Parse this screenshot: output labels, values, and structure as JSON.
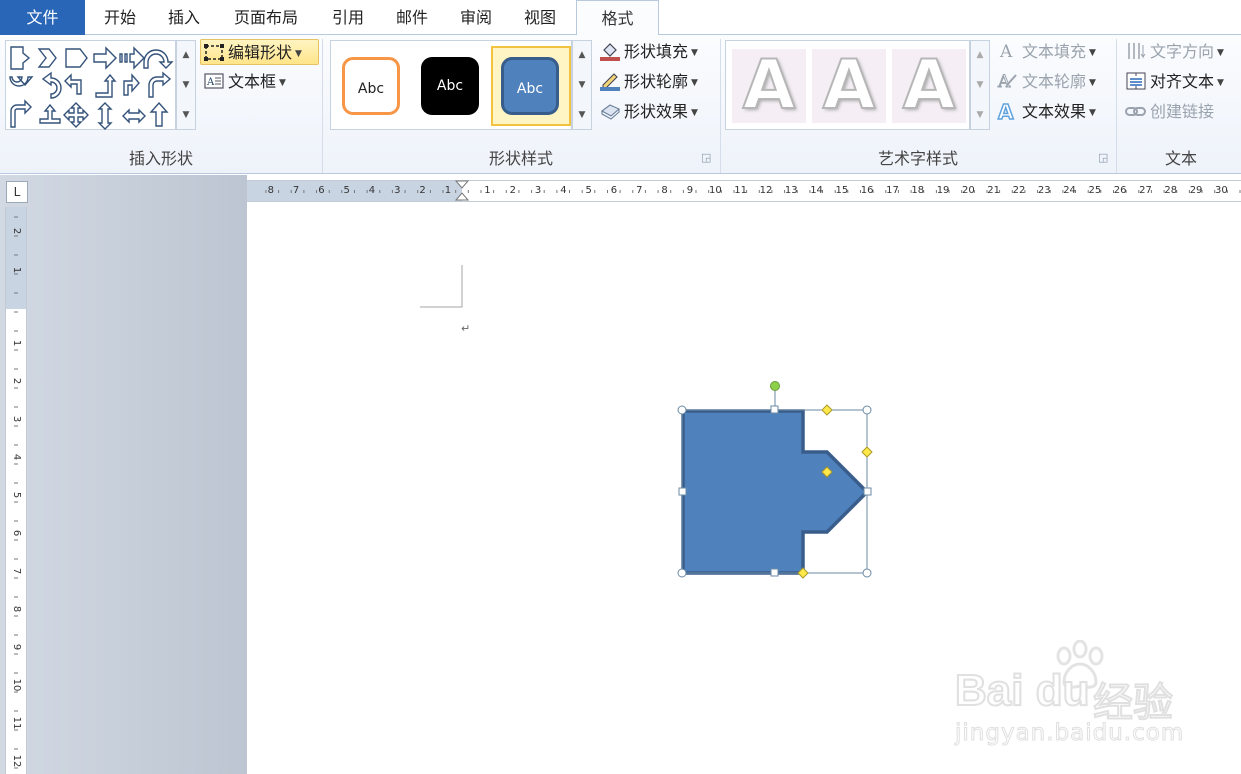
{
  "tabs": [
    {
      "label": "文件"
    },
    {
      "label": "开始"
    },
    {
      "label": "插入"
    },
    {
      "label": "页面布局"
    },
    {
      "label": "引用"
    },
    {
      "label": "邮件"
    },
    {
      "label": "审阅"
    },
    {
      "label": "视图"
    },
    {
      "label": "格式"
    }
  ],
  "groups": {
    "insert_shapes": {
      "label": "插入形状",
      "edit_shape": "编辑形状",
      "text_box": "文本框"
    },
    "shape_styles": {
      "label": "形状样式",
      "samples": [
        "Abc",
        "Abc",
        "Abc"
      ],
      "fill": "形状填充",
      "outline": "形状轮廓",
      "effects": "形状效果"
    },
    "wordart": {
      "label": "艺术字样式",
      "letter": "A",
      "text_fill": "文本填充",
      "text_outline": "文本轮廓",
      "text_effects": "文本效果"
    },
    "text": {
      "label": "文本",
      "direction": "文字方向",
      "align": "对齐文本",
      "link": "创建链接"
    }
  },
  "ruler": {
    "tab_selector": "L",
    "h_left": [
      "8",
      "7",
      "6",
      "5",
      "4",
      "3",
      "2",
      "1"
    ],
    "h_right": [
      "1",
      "2",
      "3",
      "4",
      "5",
      "6",
      "7",
      "8",
      "9",
      "10",
      "11",
      "12",
      "13",
      "14",
      "15",
      "16",
      "17",
      "18",
      "19",
      "20",
      "21",
      "22",
      "23",
      "24",
      "25",
      "26",
      "27",
      "28",
      "29",
      "30"
    ],
    "v_top": [
      "2",
      "1"
    ],
    "v_main": [
      "1",
      "2",
      "3",
      "4",
      "5",
      "6",
      "7",
      "8",
      "9",
      "10",
      "11",
      "12"
    ]
  },
  "document": {
    "paragraph_mark": "↵"
  },
  "watermark": {
    "brand": "Bai du",
    "sub": "经验",
    "url": "jingyan.baidu.com"
  },
  "colors": {
    "file_tab": "#2a66b8",
    "shape_fill": "#4f81bd",
    "shape_outline": "#385d8a",
    "sample1_outline": "#f79646",
    "selection": "#f1c341"
  }
}
